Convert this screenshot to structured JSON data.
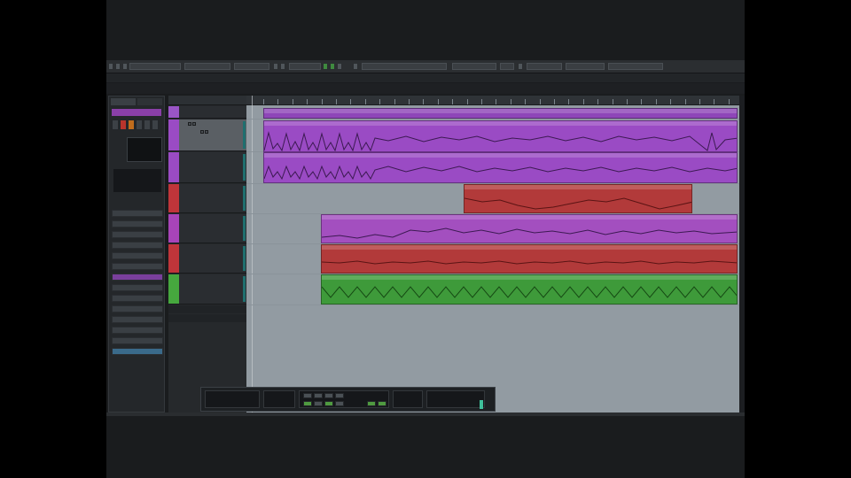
{
  "app": {
    "info_line": "",
    "sub_bar_label": ""
  },
  "inspector": {
    "tabs": [
      {
        "label": ""
      },
      {
        "label": ""
      }
    ],
    "track_name": "",
    "panel_lines": [
      "",
      ""
    ],
    "sections": [
      {
        "label": ""
      },
      {
        "label": ""
      },
      {
        "label": ""
      },
      {
        "label": ""
      },
      {
        "label": ""
      },
      {
        "label": ""
      },
      {
        "label": ""
      },
      {
        "label": ""
      },
      {
        "label": ""
      },
      {
        "label": ""
      },
      {
        "label": ""
      },
      {
        "label": ""
      },
      {
        "label": ""
      },
      {
        "label": ""
      }
    ]
  },
  "tracks": [
    {
      "name": "",
      "color": "#9a55c6"
    },
    {
      "name": "",
      "color": "#9a4bc4"
    },
    {
      "name": "",
      "color": "#9a4bc4"
    },
    {
      "name": "",
      "color": "#c0353a"
    },
    {
      "name": "",
      "color": "#a744b8"
    },
    {
      "name": "",
      "color": "#c0353a"
    },
    {
      "name": "",
      "color": "#46a83e"
    }
  ],
  "folder_rows": [
    {
      "label": ""
    },
    {
      "label": ""
    }
  ],
  "colors": {
    "purple": "#8e46b8",
    "magenta": "#a34fbf",
    "red": "#b23a3a",
    "green": "#3e9a3a",
    "arrange_bg": "#929ba2"
  }
}
